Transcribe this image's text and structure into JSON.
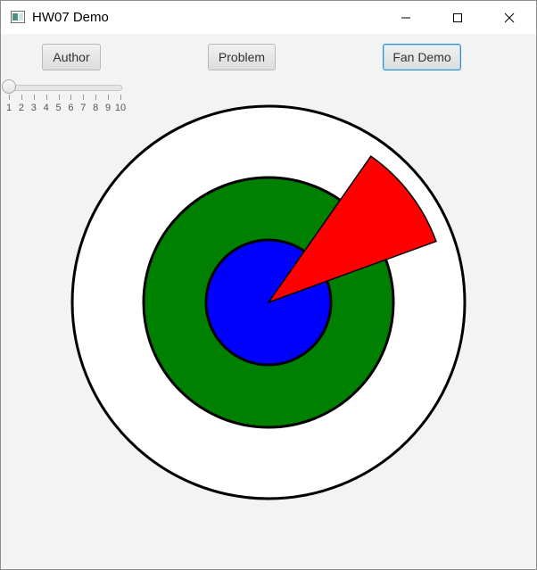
{
  "window": {
    "title": "HW07 Demo",
    "app_icon": "java-window-icon",
    "controls": {
      "minimize_icon": "minimize-icon",
      "maximize_icon": "maximize-icon",
      "close_icon": "close-icon"
    }
  },
  "toolbar": {
    "author_label": "Author",
    "problem_label": "Problem",
    "fan_demo_label": "Fan Demo"
  },
  "slider": {
    "min": 1,
    "max": 10,
    "value": 1,
    "ticks": [
      "1",
      "2",
      "3",
      "4",
      "5",
      "6",
      "7",
      "8",
      "9",
      "10"
    ]
  },
  "drawing": {
    "rings": [
      {
        "name": "outer-ring",
        "fill": "#ffffff"
      },
      {
        "name": "middle-ring",
        "fill": "#008000"
      },
      {
        "name": "inner-ring",
        "fill": "#0000ff"
      }
    ],
    "fan_blade": {
      "fill": "#ff0000",
      "start_angle_deg": 20,
      "sweep_deg": 35
    },
    "stroke": "#000000",
    "accent": "#2c8fd8"
  }
}
